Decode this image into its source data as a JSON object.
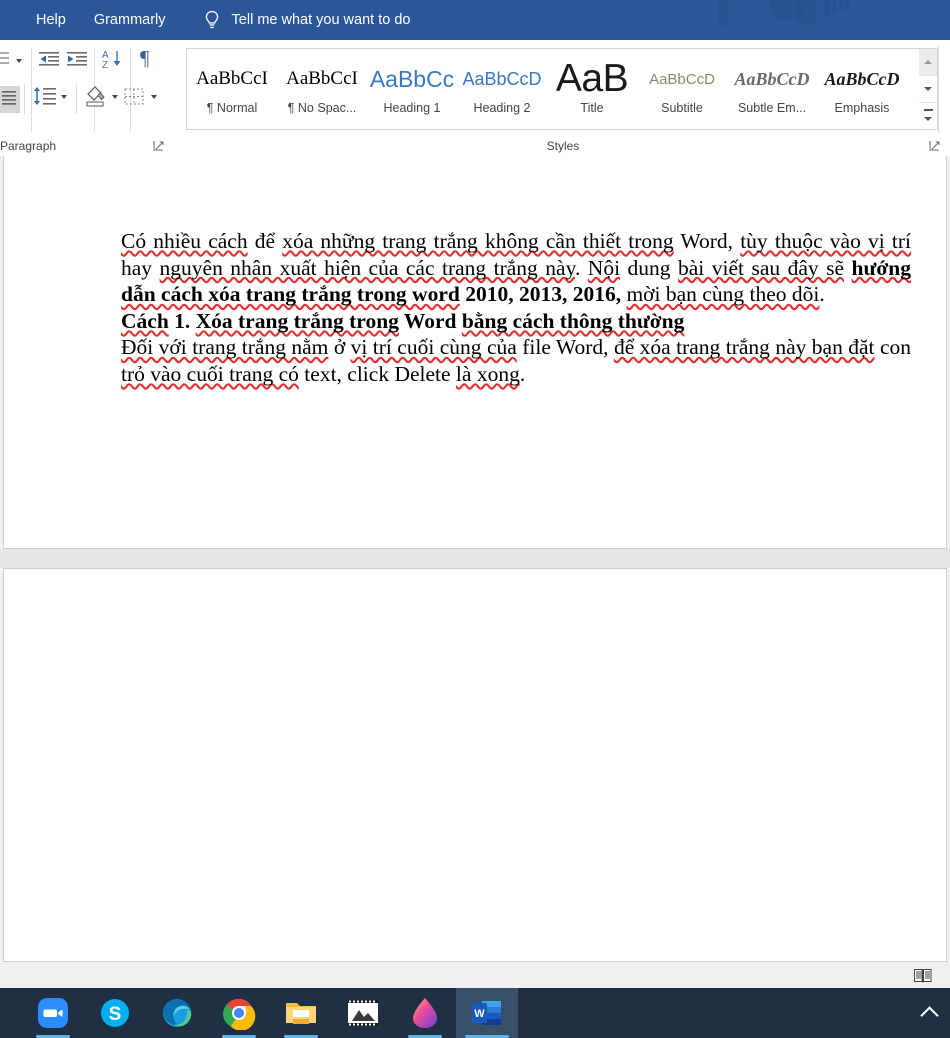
{
  "titlebar": {
    "background_color": "#2b579a",
    "items": [
      {
        "label": "Help",
        "name": "tab-help"
      },
      {
        "label": "Grammarly",
        "name": "tab-grammarly"
      }
    ],
    "lamp_icon": "lightbulb-icon",
    "tellme": "Tell me what you want to do"
  },
  "ribbon": {
    "paragraph_group": {
      "label": "Paragraph",
      "launcher_icon": "dialog-launcher-icon",
      "icons": [
        "multilevel-list-icon",
        "decrease-indent-icon",
        "increase-indent-icon",
        "sort-icon",
        "show-formatting-marks-icon",
        "align-justify-icon",
        "line-spacing-icon",
        "shading-icon",
        "borders-icon"
      ]
    },
    "styles_group": {
      "label": "Styles",
      "launcher_icon": "dialog-launcher-icon",
      "gallery": [
        {
          "sample": "AaBbCcI",
          "name": "¶ Normal",
          "style": "serif-black"
        },
        {
          "sample": "AaBbCcI",
          "name": "¶ No Spac...",
          "style": "serif-black"
        },
        {
          "sample": "AaBbCc",
          "name": "Heading 1",
          "style": "sans-blue-lg"
        },
        {
          "sample": "AaBbCcD",
          "name": "Heading 2",
          "style": "sans-blue-sm"
        },
        {
          "sample": "AaB",
          "name": "Title",
          "style": "sans-black-xl"
        },
        {
          "sample": "AaBbCcD",
          "name": "Subtitle",
          "style": "sans-gray"
        },
        {
          "sample": "AaBbCcD",
          "name": "Subtle Em...",
          "style": "serif-italic-gray"
        },
        {
          "sample": "AaBbCcD",
          "name": "Emphasis",
          "style": "serif-italic-black"
        }
      ],
      "scroll_buttons": [
        {
          "name": "gallery-scroll-up-button",
          "icon": "triangle-up-icon",
          "state": "disabled"
        },
        {
          "name": "gallery-scroll-down-button",
          "icon": "triangle-down-icon",
          "state": "enabled"
        },
        {
          "name": "gallery-more-button",
          "icon": "more-styles-icon",
          "state": "enabled"
        }
      ]
    }
  },
  "document": {
    "page_count": 2,
    "paragraphs": [
      {
        "id": "p1",
        "runs": [
          {
            "t": "Có nhiều cách để xóa những trang trắng không cần thiết trong Word, tùy thuộc vào vị trí hay nguyên nhân xuất hiện của các trang trắng này. Nội dung bài viết sau đây sẽ ",
            "bold": false
          },
          {
            "t": "hướng dẫn cách xóa trang trắng trong word 2010, 2013, 2016,",
            "bold": true
          },
          {
            "t": " mời bạn cùng theo dõi.",
            "bold": false
          }
        ]
      },
      {
        "id": "p2",
        "runs": [
          {
            "t": "Cách 1. Xóa trang trắng trong Word bằng cách thông thường",
            "bold": true
          }
        ]
      },
      {
        "id": "p3",
        "runs": [
          {
            "t": "Đối với trang trắng nằm ở vị trí cuối cùng của file Word, để xóa trang trắng này bạn đặt con trỏ vào cuối trang có text, click Delete là xong.",
            "bold": false
          }
        ]
      }
    ],
    "spellcheck_underline_color": "#e03030",
    "annotation": {
      "type": "arrow",
      "color": "#e81f29",
      "direction": "up-left",
      "name": "red-arrow-annotation"
    },
    "caret": {
      "name": "text-cursor",
      "visible": true
    }
  },
  "statusbar": {
    "read_mode_icon": "read-mode-icon"
  },
  "taskbar": {
    "background_color": "#1f3044",
    "items": [
      {
        "name": "taskbar-zoom",
        "icon": "zoom-icon",
        "label": "Zoom",
        "running": true,
        "active": false
      },
      {
        "name": "taskbar-skype",
        "icon": "skype-icon",
        "label": "Skype",
        "running": false,
        "active": false
      },
      {
        "name": "taskbar-edge",
        "icon": "edge-icon",
        "label": "Microsoft Edge",
        "running": false,
        "active": false
      },
      {
        "name": "taskbar-chrome",
        "icon": "chrome-icon",
        "label": "Google Chrome",
        "running": true,
        "active": false
      },
      {
        "name": "taskbar-file-explorer",
        "icon": "folder-icon",
        "label": "File Explorer",
        "running": true,
        "active": false
      },
      {
        "name": "taskbar-photos",
        "icon": "photos-icon",
        "label": "Photos",
        "running": false,
        "active": false
      },
      {
        "name": "taskbar-paint3d",
        "icon": "paint-3d-icon",
        "label": "Paint 3D",
        "running": true,
        "active": false
      },
      {
        "name": "taskbar-word",
        "icon": "word-icon",
        "label": "Word",
        "running": true,
        "active": true
      }
    ],
    "tray": {
      "icon": "chevron-up-icon",
      "name": "show-hidden-icons-button"
    }
  }
}
